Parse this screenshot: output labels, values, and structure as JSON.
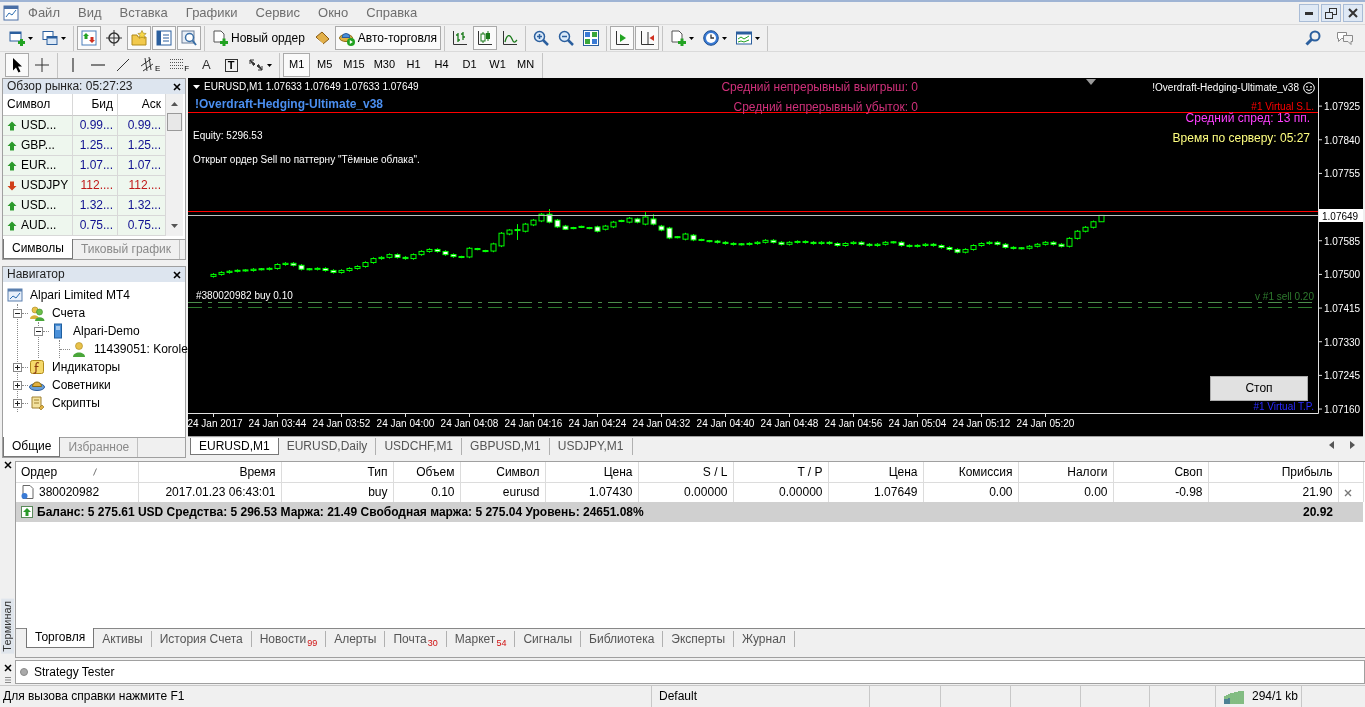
{
  "menu_bar": {
    "items": [
      "Файл",
      "Вид",
      "Вставка",
      "Графики",
      "Сервис",
      "Окно",
      "Справка"
    ]
  },
  "toolbar": {
    "panels": [
      {
        "kind": "market_watch",
        "on": true
      },
      {
        "kind": "data_window",
        "on": false
      },
      {
        "kind": "navigator",
        "on": true
      },
      {
        "kind": "terminal",
        "on": true
      },
      {
        "kind": "tester",
        "on": true
      }
    ],
    "new_order": "Новый ордер",
    "auto_trading": {
      "label": "Авто-торговля",
      "on": true
    },
    "chart_types": [
      {
        "kind": "bars",
        "selected": false
      },
      {
        "kind": "candles",
        "selected": true
      },
      {
        "kind": "line",
        "selected": false
      }
    ],
    "chart_options": [
      {
        "kind": "autoscroll",
        "on": true
      },
      {
        "kind": "shift",
        "on": true
      }
    ]
  },
  "drawing_tools": [
    {
      "kind": "cursor",
      "selected": true
    },
    {
      "kind": "crosshair",
      "selected": false
    },
    {
      "kind": "vertical_line",
      "selected": false
    },
    {
      "kind": "horizontal_line",
      "selected": false
    },
    {
      "kind": "trend_line",
      "selected": false
    },
    {
      "kind": "channel",
      "glyph": "E",
      "selected": false
    },
    {
      "kind": "fibo",
      "glyph": "F",
      "selected": false
    },
    {
      "kind": "text",
      "glyph": "A",
      "selected": false
    },
    {
      "kind": "label",
      "glyph": "T",
      "selected": false
    },
    {
      "kind": "arrows",
      "selected": false
    }
  ],
  "timeframes": [
    {
      "label": "M1",
      "selected": true
    },
    {
      "label": "M5",
      "selected": false
    },
    {
      "label": "M15",
      "selected": false
    },
    {
      "label": "M30",
      "selected": false
    },
    {
      "label": "H1",
      "selected": false
    },
    {
      "label": "H4",
      "selected": false
    },
    {
      "label": "D1",
      "selected": false
    },
    {
      "label": "W1",
      "selected": false
    },
    {
      "label": "MN",
      "selected": false
    }
  ],
  "market_watch": {
    "title": "Обзор рынка: 05:27:23",
    "columns": [
      "Символ",
      "Бид",
      "Аск"
    ],
    "rows": [
      {
        "symbol": "USD...",
        "bid": "0.99...",
        "ask": "0.99...",
        "rising": true
      },
      {
        "symbol": "GBP...",
        "bid": "1.25...",
        "ask": "1.25...",
        "rising": true
      },
      {
        "symbol": "EUR...",
        "bid": "1.07...",
        "ask": "1.07...",
        "rising": true
      },
      {
        "symbol": "USDJPY",
        "bid": "112....",
        "ask": "112....",
        "rising": false
      },
      {
        "symbol": "USD...",
        "bid": "1.32...",
        "ask": "1.32...",
        "rising": true
      },
      {
        "symbol": "AUD...",
        "bid": "0.75...",
        "ask": "0.75...",
        "rising": true
      }
    ],
    "tabs": [
      {
        "label": "Символы",
        "selected": true
      },
      {
        "label": "Тиковый график",
        "selected": false
      }
    ]
  },
  "navigator": {
    "title": "Навигатор",
    "tree": [
      {
        "label": "Alpari Limited MT4",
        "kind": "terminal",
        "children": [
          {
            "label": "Счета",
            "kind": "accounts",
            "expanded": true,
            "children": [
              {
                "label": "Alpari-Demo",
                "kind": "server",
                "expanded": true,
                "children": [
                  {
                    "label": "11439051: Korole",
                    "kind": "account"
                  }
                ]
              }
            ]
          },
          {
            "label": "Индикаторы",
            "kind": "indicators",
            "expanded": false
          },
          {
            "label": "Советники",
            "kind": "experts",
            "expanded": false
          },
          {
            "label": "Скрипты",
            "kind": "scripts",
            "expanded": false
          }
        ]
      }
    ],
    "tabs": [
      {
        "label": "Общие",
        "selected": true
      },
      {
        "label": "Избранное",
        "selected": false
      }
    ]
  },
  "chart": {
    "header": "EURUSD,M1  1.07633 1.07649 1.07633 1.07649",
    "stats": [
      "Средний непрерывный выигрыш: 0",
      "Средний непрерывный убыток: 0"
    ],
    "expert_title": "!Overdraft-Hedging-Ultimate_v38",
    "expert_name": "!Overdraft-Hedging-Ultimate_v38",
    "equity": "Equity: 5296.53",
    "message": "Открыт ордер Sell по паттерну \"Тёмные облака\".",
    "info_lines": [
      {
        "text": "Средний спред: 13 пп.",
        "color": "#ff40ff"
      },
      {
        "text": "Время по серверу: 05:27",
        "color": "#ffff80"
      }
    ],
    "stop_button": "Стоп",
    "chart_data": [
      {
        "type": "candlestick",
        "xlim": [
          "2017-01-24T03:33",
          "2017-01-24T05:54"
        ],
        "ylim": [
          1.0715,
          1.07996
        ],
        "yticks": [
          {
            "value": 1.07925,
            "label": "1.07925"
          },
          {
            "value": 1.0784,
            "label": "1.07840"
          },
          {
            "value": 1.07755,
            "label": "1.07755"
          },
          {
            "value": 1.07585,
            "label": "1.07585"
          },
          {
            "value": 1.075,
            "label": "1.07500"
          },
          {
            "value": 1.07415,
            "label": "1.07415"
          },
          {
            "value": 1.0733,
            "label": "1.07330"
          },
          {
            "value": 1.07245,
            "label": "1.07245"
          },
          {
            "value": 1.0716,
            "label": "1.07160"
          }
        ],
        "xticks": [
          {
            "value": "2017-01-24T03:36",
            "label": "24 Jan 2017"
          },
          {
            "value": "2017-01-24T03:44",
            "label": "24 Jan 03:44"
          },
          {
            "value": "2017-01-24T03:52",
            "label": "24 Jan 03:52"
          },
          {
            "value": "2017-01-24T04:00",
            "label": "24 Jan 04:00"
          },
          {
            "value": "2017-01-24T04:08",
            "label": "24 Jan 04:08"
          },
          {
            "value": "2017-01-24T04:16",
            "label": "24 Jan 04:16"
          },
          {
            "value": "2017-01-24T04:24",
            "label": "24 Jan 04:24"
          },
          {
            "value": "2017-01-24T04:32",
            "label": "24 Jan 04:32"
          },
          {
            "value": "2017-01-24T04:40",
            "label": "24 Jan 04:40"
          },
          {
            "value": "2017-01-24T04:48",
            "label": "24 Jan 04:48"
          },
          {
            "value": "2017-01-24T04:56",
            "label": "24 Jan 04:56"
          },
          {
            "value": "2017-01-24T05:04",
            "label": "24 Jan 05:04"
          },
          {
            "value": "2017-01-24T05:12",
            "label": "24 Jan 05:12"
          },
          {
            "value": "2017-01-24T05:20",
            "label": "24 Jan 05:20"
          }
        ],
        "x": [
          "2017-01-24T03:36",
          "2017-01-24T03:37",
          "2017-01-24T03:38",
          "2017-01-24T03:39",
          "2017-01-24T03:40",
          "2017-01-24T03:41",
          "2017-01-24T03:42",
          "2017-01-24T03:43",
          "2017-01-24T03:44",
          "2017-01-24T03:45",
          "2017-01-24T03:46",
          "2017-01-24T03:47",
          "2017-01-24T03:48",
          "2017-01-24T03:49",
          "2017-01-24T03:50",
          "2017-01-24T03:51",
          "2017-01-24T03:52",
          "2017-01-24T03:53",
          "2017-01-24T03:54",
          "2017-01-24T03:55",
          "2017-01-24T03:56",
          "2017-01-24T03:57",
          "2017-01-24T03:58",
          "2017-01-24T03:59",
          "2017-01-24T04:00",
          "2017-01-24T04:01",
          "2017-01-24T04:02",
          "2017-01-24T04:03",
          "2017-01-24T04:04",
          "2017-01-24T04:05",
          "2017-01-24T04:06",
          "2017-01-24T04:07",
          "2017-01-24T04:08",
          "2017-01-24T04:09",
          "2017-01-24T04:10",
          "2017-01-24T04:11",
          "2017-01-24T04:12",
          "2017-01-24T04:13",
          "2017-01-24T04:14",
          "2017-01-24T04:15",
          "2017-01-24T04:16",
          "2017-01-24T04:17",
          "2017-01-24T04:18",
          "2017-01-24T04:19",
          "2017-01-24T04:20",
          "2017-01-24T04:21",
          "2017-01-24T04:22",
          "2017-01-24T04:23",
          "2017-01-24T04:24",
          "2017-01-24T04:25",
          "2017-01-24T04:26",
          "2017-01-24T04:27",
          "2017-01-24T04:28",
          "2017-01-24T04:29",
          "2017-01-24T04:30",
          "2017-01-24T04:31",
          "2017-01-24T04:32",
          "2017-01-24T04:33",
          "2017-01-24T04:34",
          "2017-01-24T04:35",
          "2017-01-24T04:36",
          "2017-01-24T04:37",
          "2017-01-24T04:38",
          "2017-01-24T04:39",
          "2017-01-24T04:40",
          "2017-01-24T04:41",
          "2017-01-24T04:42",
          "2017-01-24T04:43",
          "2017-01-24T04:44",
          "2017-01-24T04:45",
          "2017-01-24T04:46",
          "2017-01-24T04:47",
          "2017-01-24T04:48",
          "2017-01-24T04:49",
          "2017-01-24T04:50",
          "2017-01-24T04:51",
          "2017-01-24T04:52",
          "2017-01-24T04:53",
          "2017-01-24T04:54",
          "2017-01-24T04:55",
          "2017-01-24T04:56",
          "2017-01-24T04:57",
          "2017-01-24T04:58",
          "2017-01-24T04:59",
          "2017-01-24T05:00",
          "2017-01-24T05:01",
          "2017-01-24T05:02",
          "2017-01-24T05:03",
          "2017-01-24T05:04",
          "2017-01-24T05:05",
          "2017-01-24T05:06",
          "2017-01-24T05:07",
          "2017-01-24T05:08",
          "2017-01-24T05:09",
          "2017-01-24T05:10",
          "2017-01-24T05:11",
          "2017-01-24T05:12",
          "2017-01-24T05:13",
          "2017-01-24T05:14",
          "2017-01-24T05:15",
          "2017-01-24T05:16",
          "2017-01-24T05:17",
          "2017-01-24T05:18",
          "2017-01-24T05:19",
          "2017-01-24T05:20",
          "2017-01-24T05:21",
          "2017-01-24T05:22",
          "2017-01-24T05:23",
          "2017-01-24T05:24",
          "2017-01-24T05:25",
          "2017-01-24T05:26",
          "2017-01-24T05:27"
        ],
        "ohlc": [
          [
            1.07495,
            1.07503,
            1.07492,
            1.075
          ],
          [
            1.075,
            1.07508,
            1.07497,
            1.07505
          ],
          [
            1.07505,
            1.07511,
            1.07502,
            1.07508
          ],
          [
            1.07508,
            1.07513,
            1.07505,
            1.0751
          ],
          [
            1.0751,
            1.07513,
            1.07507,
            1.0751
          ],
          [
            1.0751,
            1.07516,
            1.07507,
            1.07513
          ],
          [
            1.07513,
            1.07516,
            1.0751,
            1.07513
          ],
          [
            1.07513,
            1.07518,
            1.0751,
            1.07515
          ],
          [
            1.07515,
            1.07528,
            1.07512,
            1.07525
          ],
          [
            1.07525,
            1.07531,
            1.07522,
            1.07528
          ],
          [
            1.07528,
            1.07531,
            1.0752,
            1.07523
          ],
          [
            1.07523,
            1.07526,
            1.0751,
            1.07513
          ],
          [
            1.07513,
            1.07516,
            1.0751,
            1.07513
          ],
          [
            1.07513,
            1.07518,
            1.0751,
            1.07515
          ],
          [
            1.07515,
            1.07518,
            1.07507,
            1.0751
          ],
          [
            1.0751,
            1.07513,
            1.07502,
            1.07505
          ],
          [
            1.07505,
            1.07513,
            1.07502,
            1.0751
          ],
          [
            1.0751,
            1.07518,
            1.07507,
            1.07515
          ],
          [
            1.07515,
            1.07523,
            1.07512,
            1.0752
          ],
          [
            1.0752,
            1.07533,
            1.07517,
            1.0753
          ],
          [
            1.0753,
            1.07543,
            1.07527,
            1.0754
          ],
          [
            1.0754,
            1.07546,
            1.07537,
            1.07543
          ],
          [
            1.07543,
            1.07553,
            1.0754,
            1.0755
          ],
          [
            1.0755,
            1.07553,
            1.0754,
            1.07543
          ],
          [
            1.07543,
            1.07546,
            1.07537,
            1.0754
          ],
          [
            1.0754,
            1.07553,
            1.07537,
            1.0755
          ],
          [
            1.0755,
            1.07561,
            1.07547,
            1.07558
          ],
          [
            1.07558,
            1.07566,
            1.07555,
            1.07563
          ],
          [
            1.07563,
            1.07566,
            1.07555,
            1.07558
          ],
          [
            1.07558,
            1.07561,
            1.07547,
            1.0755
          ],
          [
            1.0755,
            1.07553,
            1.07542,
            1.07545
          ],
          [
            1.07544,
            1.07547,
            1.07541,
            1.07544
          ],
          [
            1.07544,
            1.07569,
            1.07541,
            1.07566
          ],
          [
            1.07564,
            1.07567,
            1.07561,
            1.07564
          ],
          [
            1.07559,
            1.07562,
            1.07556,
            1.07559
          ],
          [
            1.07559,
            1.0758,
            1.07556,
            1.07577
          ],
          [
            1.07572,
            1.07607,
            1.07569,
            1.07604
          ],
          [
            1.07602,
            1.07614,
            1.07599,
            1.07612
          ],
          [
            1.07612,
            1.07627,
            1.07587,
            1.07612
          ],
          [
            1.07609,
            1.0763,
            1.07606,
            1.07627
          ],
          [
            1.07625,
            1.0764,
            1.07622,
            1.07637
          ],
          [
            1.07635,
            1.07655,
            1.07632,
            1.07652
          ],
          [
            1.07652,
            1.07665,
            1.07629,
            1.07632
          ],
          [
            1.07637,
            1.0764,
            1.07617,
            1.0762
          ],
          [
            1.07622,
            1.07625,
            1.07612,
            1.07614
          ],
          [
            1.07617,
            1.0762,
            1.07614,
            1.07617
          ],
          [
            1.0762,
            1.07623,
            1.07617,
            1.0762
          ],
          [
            1.07617,
            1.0762,
            1.07614,
            1.07617
          ],
          [
            1.0762,
            1.07623,
            1.07606,
            1.07609
          ],
          [
            1.07614,
            1.07625,
            1.07611,
            1.07622
          ],
          [
            1.0762,
            1.07635,
            1.07617,
            1.07632
          ],
          [
            1.07635,
            1.07638,
            1.07632,
            1.07635
          ],
          [
            1.07632,
            1.07645,
            1.07629,
            1.07642
          ],
          [
            1.0764,
            1.07643,
            1.07629,
            1.07632
          ],
          [
            1.07627,
            1.07657,
            1.07624,
            1.07645
          ],
          [
            1.0764,
            1.07652,
            1.07624,
            1.07627
          ],
          [
            1.07622,
            1.07625,
            1.07609,
            1.07612
          ],
          [
            1.07617,
            1.0762,
            1.07589,
            1.07592
          ],
          [
            1.07594,
            1.07597,
            1.07591,
            1.07594
          ],
          [
            1.07589,
            1.07605,
            1.07586,
            1.07602
          ],
          [
            1.07599,
            1.07602,
            1.07584,
            1.07587
          ],
          [
            1.07587,
            1.0759,
            1.07584,
            1.07587
          ],
          [
            1.07584,
            1.07587,
            1.07581,
            1.07584
          ],
          [
            1.07584,
            1.07587,
            1.07578,
            1.07581
          ],
          [
            1.07581,
            1.07584,
            1.07575,
            1.07578
          ],
          [
            1.07578,
            1.07581,
            1.07573,
            1.07576
          ],
          [
            1.07576,
            1.07579,
            1.07573,
            1.07576
          ],
          [
            1.07576,
            1.07581,
            1.07573,
            1.07578
          ],
          [
            1.07578,
            1.07584,
            1.07575,
            1.07581
          ],
          [
            1.07581,
            1.07589,
            1.07578,
            1.07586
          ],
          [
            1.07586,
            1.07589,
            1.07578,
            1.07581
          ],
          [
            1.07581,
            1.07584,
            1.07573,
            1.07576
          ],
          [
            1.07576,
            1.07584,
            1.07573,
            1.07581
          ],
          [
            1.07581,
            1.07586,
            1.07578,
            1.07583
          ],
          [
            1.07583,
            1.07586,
            1.07578,
            1.07581
          ],
          [
            1.07581,
            1.07584,
            1.07575,
            1.07578
          ],
          [
            1.07578,
            1.07584,
            1.07575,
            1.07581
          ],
          [
            1.07581,
            1.07584,
            1.07575,
            1.07578
          ],
          [
            1.07578,
            1.07581,
            1.0757,
            1.07573
          ],
          [
            1.07573,
            1.07581,
            1.0757,
            1.07578
          ],
          [
            1.07578,
            1.07584,
            1.07575,
            1.07581
          ],
          [
            1.07581,
            1.07584,
            1.07573,
            1.07576
          ],
          [
            1.07576,
            1.07579,
            1.0757,
            1.07573
          ],
          [
            1.07573,
            1.07579,
            1.0757,
            1.07576
          ],
          [
            1.07576,
            1.07584,
            1.07573,
            1.07581
          ],
          [
            1.07581,
            1.07584,
            1.07578,
            1.07581
          ],
          [
            1.07581,
            1.07584,
            1.0757,
            1.07573
          ],
          [
            1.07573,
            1.07576,
            1.07568,
            1.07571
          ],
          [
            1.07571,
            1.07576,
            1.07568,
            1.07573
          ],
          [
            1.07573,
            1.07579,
            1.0757,
            1.07576
          ],
          [
            1.07576,
            1.07579,
            1.0757,
            1.07573
          ],
          [
            1.07573,
            1.07576,
            1.07565,
            1.07568
          ],
          [
            1.07568,
            1.07571,
            1.0756,
            1.07563
          ],
          [
            1.07563,
            1.07566,
            1.07553,
            1.07556
          ],
          [
            1.07556,
            1.07566,
            1.07553,
            1.07563
          ],
          [
            1.07563,
            1.07576,
            1.0756,
            1.07573
          ],
          [
            1.07573,
            1.07581,
            1.0757,
            1.07578
          ],
          [
            1.07578,
            1.07584,
            1.07575,
            1.07581
          ],
          [
            1.07581,
            1.07584,
            1.07573,
            1.07576
          ],
          [
            1.07576,
            1.07579,
            1.07565,
            1.07568
          ],
          [
            1.07568,
            1.07571,
            1.07563,
            1.07566
          ],
          [
            1.07566,
            1.07569,
            1.07563,
            1.07566
          ],
          [
            1.07566,
            1.07574,
            1.07563,
            1.07571
          ],
          [
            1.07571,
            1.07579,
            1.07568,
            1.07576
          ],
          [
            1.07576,
            1.07584,
            1.07573,
            1.07581
          ],
          [
            1.07581,
            1.07584,
            1.07573,
            1.07576
          ],
          [
            1.07576,
            1.07579,
            1.07568,
            1.07571
          ],
          [
            1.07571,
            1.07594,
            1.07568,
            1.07591
          ],
          [
            1.07591,
            1.07612,
            1.07588,
            1.07609
          ],
          [
            1.07609,
            1.07622,
            1.07606,
            1.07619
          ],
          [
            1.07619,
            1.07636,
            1.07616,
            1.07633
          ],
          [
            1.07633,
            1.07649,
            1.07633,
            1.07649
          ]
        ],
        "ref_lines": [
          {
            "axis": "y",
            "value": 1.0791,
            "label": "#1 Virtual S.L.",
            "color": "#ff0000"
          },
          {
            "axis": "y",
            "value": 1.07661,
            "color": "#ff0000"
          },
          {
            "axis": "y",
            "value": 1.07649,
            "label": "1.07649",
            "color": "#c0c0c0"
          },
          {
            "axis": "y",
            "value": 1.0743,
            "label": "#380020982 buy 0.10",
            "color": "#4c8c4c",
            "line_style": "dashdot"
          },
          {
            "axis": "y",
            "value": 1.07418,
            "label": "v #1 sell 0.20",
            "color": "#2e7a2e",
            "line_style": "dashdot"
          }
        ],
        "annotations": [
          "#1 Virtual T.P."
        ]
      }
    ]
  },
  "chart_tabs": [
    {
      "label": "EURUSD,M1",
      "selected": true
    },
    {
      "label": "EURUSD,Daily",
      "selected": false
    },
    {
      "label": "USDCHF,M1",
      "selected": false
    },
    {
      "label": "GBPUSD,M1",
      "selected": false
    },
    {
      "label": "USDJPY,M1",
      "selected": false
    }
  ],
  "terminal": {
    "title": "Терминал",
    "columns": [
      "Ордер",
      "Время",
      "Тип",
      "Объем",
      "Символ",
      "Цена",
      "S / L",
      "T / P",
      "Цена",
      "Комиссия",
      "Налоги",
      "Своп",
      "Прибыль"
    ],
    "orders": [
      {
        "cells": [
          "380020982",
          "2017.01.23 06:43:01",
          "buy",
          "0.10",
          "eurusd",
          "1.07430",
          "0.00000",
          "0.00000",
          "1.07649",
          "0.00",
          "0.00",
          "-0.98",
          "21.90"
        ]
      }
    ],
    "summary": {
      "text": "Баланс: 5 275.61 USD  Средства: 5 296.53  Маржа: 21.49  Свободная маржа: 5 275.04  Уровень: 24651.08%",
      "profit": "20.92"
    },
    "tabs": [
      {
        "label": "Торговля",
        "selected": true
      },
      {
        "label": "Активы",
        "selected": false
      },
      {
        "label": "История Счета",
        "selected": false
      },
      {
        "label": "Новости",
        "count": "99",
        "selected": false
      },
      {
        "label": "Алерты",
        "selected": false
      },
      {
        "label": "Почта",
        "count": "30",
        "selected": false
      },
      {
        "label": "Маркет",
        "count": "54",
        "selected": false
      },
      {
        "label": "Сигналы",
        "selected": false
      },
      {
        "label": "Библиотека",
        "selected": false
      },
      {
        "label": "Эксперты",
        "selected": false
      },
      {
        "label": "Журнал",
        "selected": false
      }
    ]
  },
  "strategy_tester": {
    "title": "Strategy Tester"
  },
  "status_bar": {
    "help": "Для вызова справки нажмите F1",
    "profile": "Default",
    "traffic": "294/1 kb"
  }
}
